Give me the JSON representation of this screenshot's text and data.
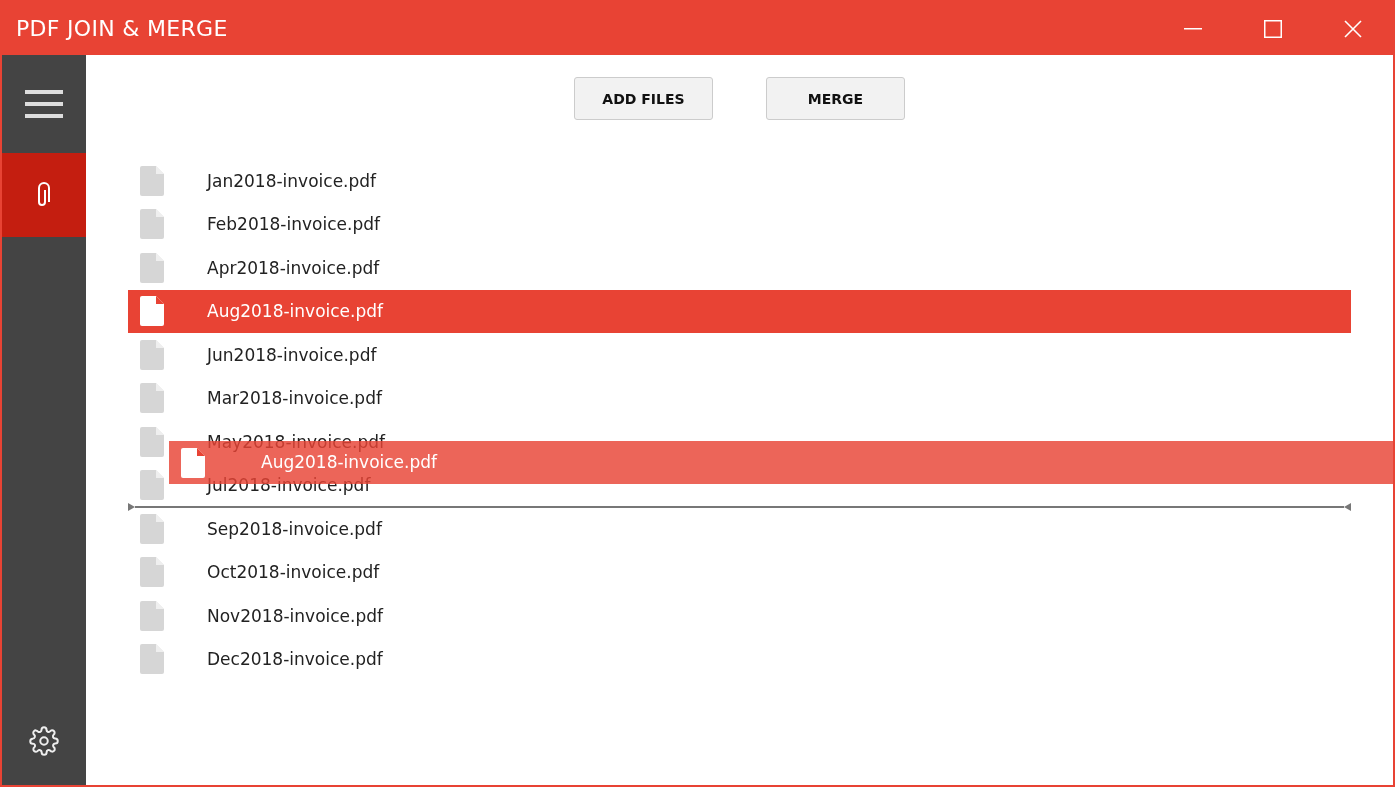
{
  "window": {
    "title": "PDF JOIN & MERGE"
  },
  "sidebar": {
    "items": [
      {
        "kind": "menu",
        "selected": false
      },
      {
        "kind": "attach",
        "selected": true
      },
      {
        "kind": "settings",
        "selected": false
      }
    ]
  },
  "toolbar": {
    "buttons": [
      "ADD FILES",
      "MERGE"
    ]
  },
  "files": [
    {
      "name": "Jan2018-invoice.pdf",
      "selected": false,
      "drop_indicator": false
    },
    {
      "name": "Feb2018-invoice.pdf",
      "selected": false,
      "drop_indicator": false
    },
    {
      "name": "Apr2018-invoice.pdf",
      "selected": false,
      "drop_indicator": false
    },
    {
      "name": "Aug2018-invoice.pdf",
      "selected": true,
      "drop_indicator": false
    },
    {
      "name": "Jun2018-invoice.pdf",
      "selected": false,
      "drop_indicator": false
    },
    {
      "name": "Mar2018-invoice.pdf",
      "selected": false,
      "drop_indicator": false
    },
    {
      "name": "May2018-invoice.pdf",
      "selected": false,
      "drop_indicator": false
    },
    {
      "name": "Jul2018-invoice.pdf",
      "selected": false,
      "drop_indicator": false
    },
    {
      "name": "Sep2018-invoice.pdf",
      "selected": false,
      "drop_indicator": true
    },
    {
      "name": "Oct2018-invoice.pdf",
      "selected": false,
      "drop_indicator": false
    },
    {
      "name": "Nov2018-invoice.pdf",
      "selected": false,
      "drop_indicator": false
    },
    {
      "name": "Dec2018-invoice.pdf",
      "selected": false,
      "drop_indicator": false
    }
  ],
  "drag_ghost": {
    "name": "Aug2018-invoice.pdf"
  }
}
